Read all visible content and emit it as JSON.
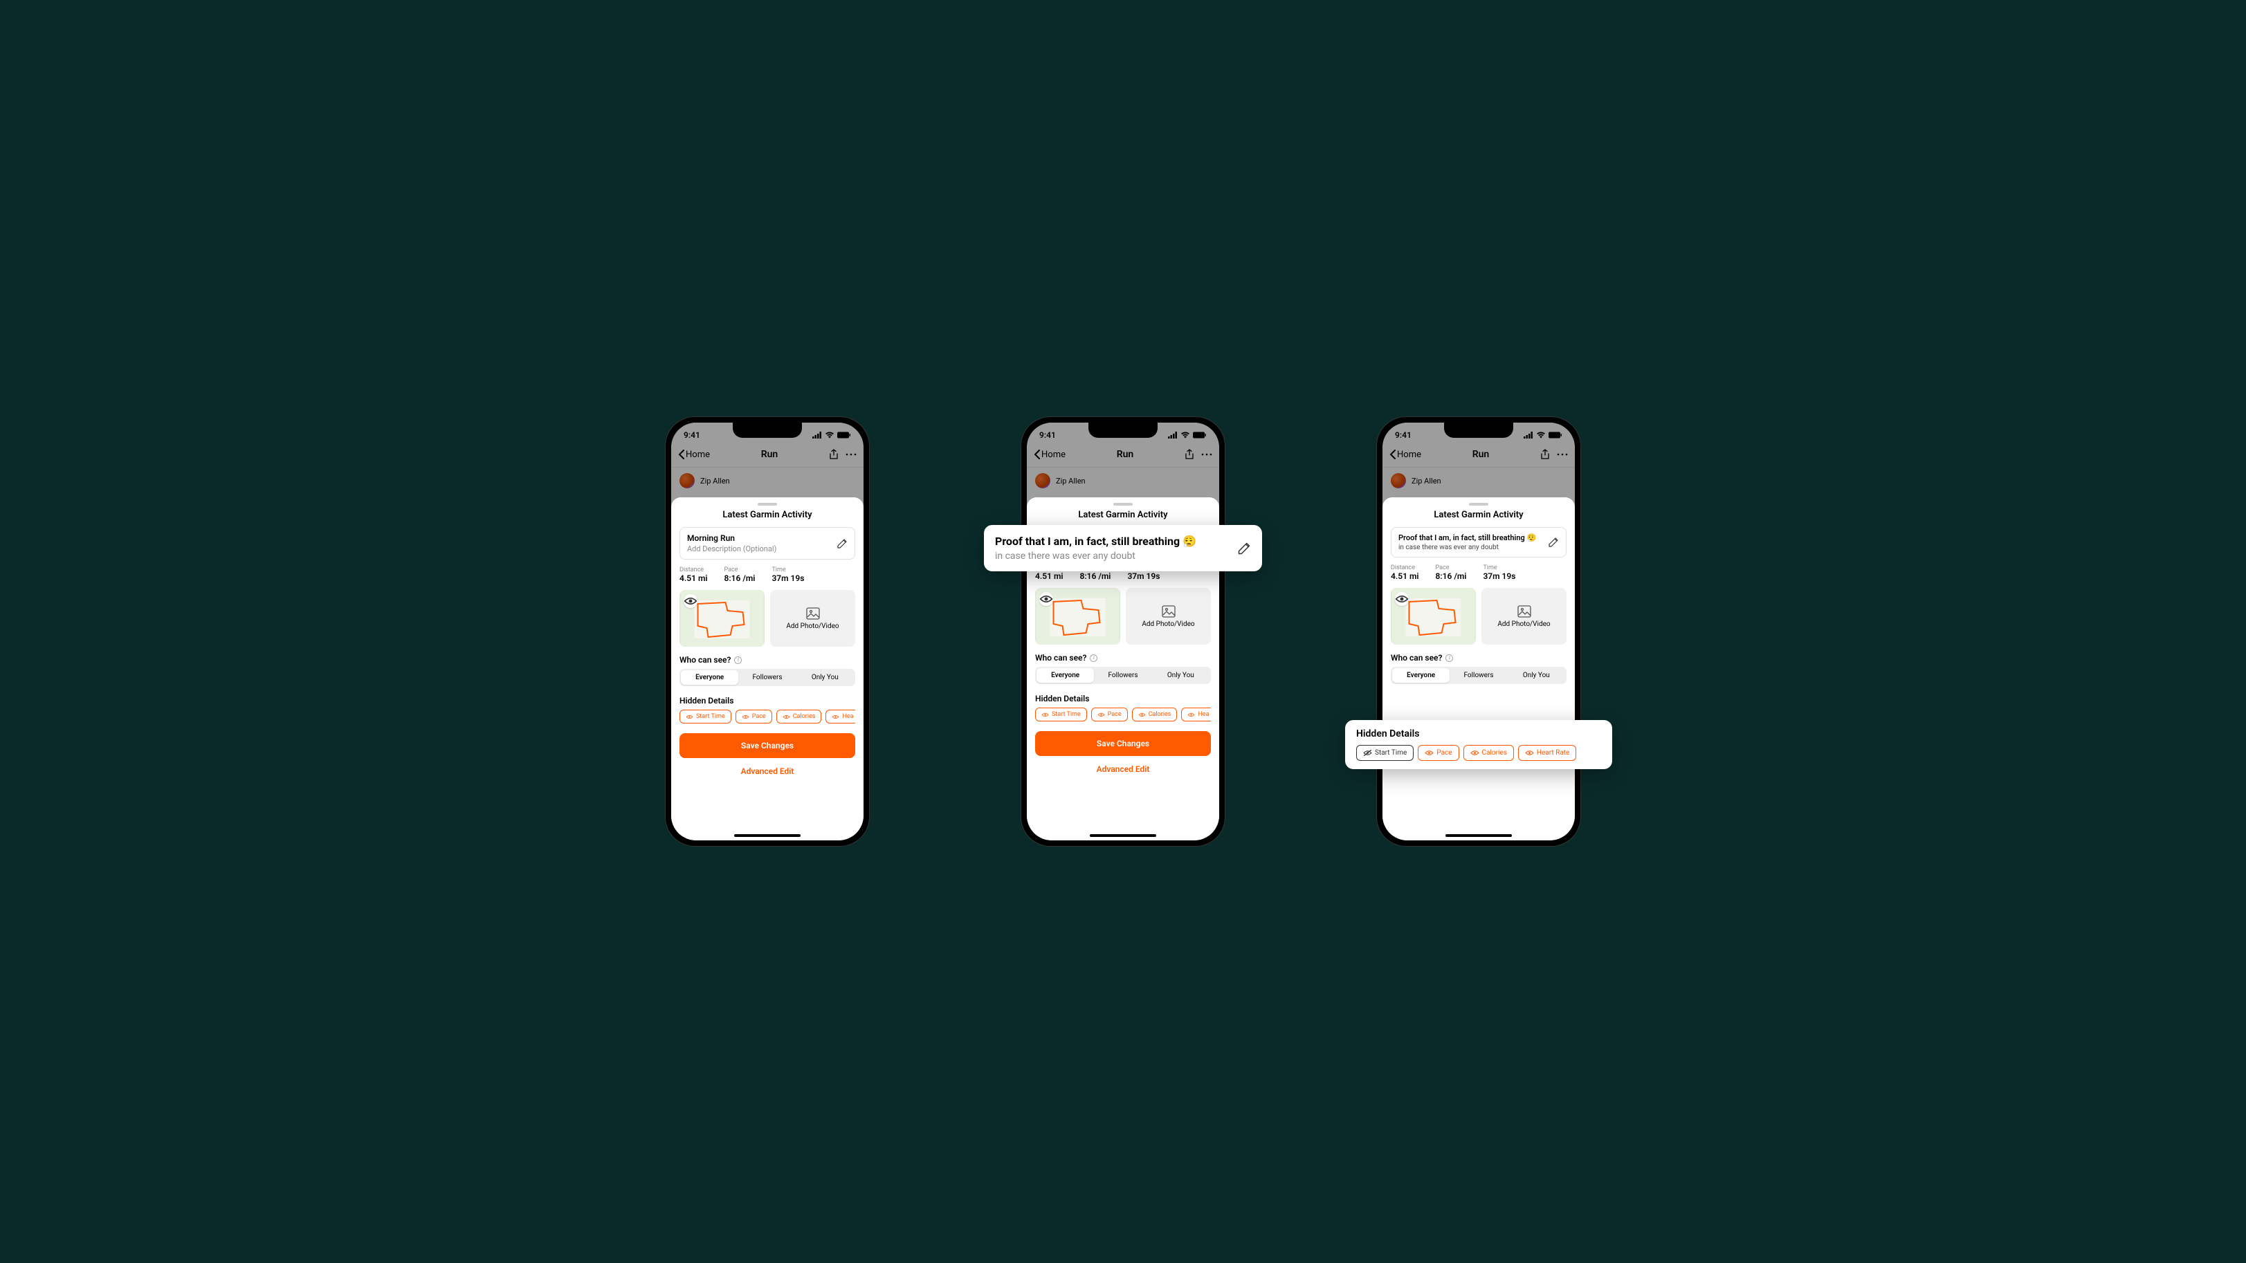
{
  "colors": {
    "accent": "#ff5a00",
    "background": "#0a2a2a"
  },
  "status": {
    "time": "9:41",
    "signal_icon": "cellular-icon",
    "wifi_icon": "wifi-icon",
    "battery_icon": "battery-icon"
  },
  "nav": {
    "back_label": "Home",
    "title": "Run",
    "share_icon": "share-icon",
    "more_icon": "more-icon"
  },
  "profile": {
    "name": "Zip Allen"
  },
  "sheet_title": "Latest Garmin Activity",
  "phones": [
    {
      "title_card": {
        "title": "Morning Run",
        "description": "Add Description (Optional)",
        "mode": "empty"
      }
    },
    {
      "title_card": {
        "title": "Proof that I am, in fact, still breathing 😮‍💨",
        "description": "in case there was ever any doubt",
        "mode": "popout"
      }
    },
    {
      "title_card": {
        "title": "Proof that I am, in fact, still breathing 😮‍💨",
        "description": "in case there was ever any doubt",
        "mode": "filled"
      }
    }
  ],
  "stats": {
    "distance_label": "Distance",
    "distance_value": "4.51 mi",
    "pace_label": "Pace",
    "pace_value": "8:16 /mi",
    "time_label": "Time",
    "time_value": "37m 19s"
  },
  "media": {
    "add_photo_label": "Add Photo/Video"
  },
  "visibility": {
    "label": "Who can see?",
    "options": [
      "Everyone",
      "Followers",
      "Only You"
    ],
    "selected": "Everyone"
  },
  "hidden": {
    "label": "Hidden Details",
    "chips_cropped": [
      "Start Time",
      "Pace",
      "Calories",
      "Hea"
    ],
    "chips_full": [
      "Start Time",
      "Pace",
      "Calories",
      "Heart Rate"
    ]
  },
  "actions": {
    "save_label": "Save Changes",
    "advanced_label": "Advanced Edit"
  }
}
